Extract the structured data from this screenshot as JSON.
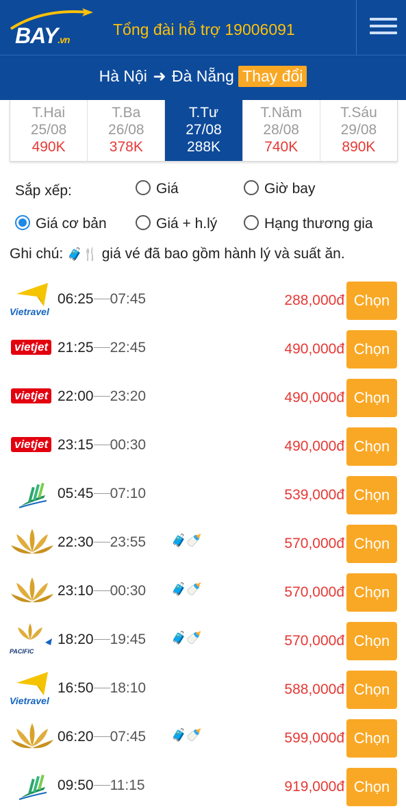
{
  "header": {
    "logo_main": "BAY",
    "logo_suffix": ".vn",
    "hotline": "Tổng đài hỗ trợ 19006091"
  },
  "route": {
    "from": "Hà Nội",
    "to": "Đà Nẵng",
    "change_label": "Thay đổi"
  },
  "dates": [
    {
      "day": "T.Hai",
      "date": "25/08",
      "price": "490K",
      "active": false
    },
    {
      "day": "T.Ba",
      "date": "26/08",
      "price": "378K",
      "active": false
    },
    {
      "day": "T.Tư",
      "date": "27/08",
      "price": "288K",
      "active": true
    },
    {
      "day": "T.Năm",
      "date": "28/08",
      "price": "740K",
      "active": false
    },
    {
      "day": "T.Sáu",
      "date": "29/08",
      "price": "890K",
      "active": false
    }
  ],
  "sort": {
    "label": "Sắp xếp:",
    "options": [
      {
        "label": "Giá",
        "checked": false
      },
      {
        "label": "Giờ bay",
        "checked": false
      },
      {
        "label": "Giá cơ bản",
        "checked": true
      },
      {
        "label": "Giá + h.lý",
        "checked": false
      },
      {
        "label": "Hạng thương gia",
        "checked": false
      }
    ]
  },
  "note": {
    "prefix": "Ghi chú:",
    "text": "giá vé đã bao gồm hành lý và suất ăn."
  },
  "choose_label": "Chọn",
  "airline_labels": {
    "vietravel": "Vietravel",
    "vietjet": "vietjet",
    "pacific": "PACIFIC"
  },
  "flights": [
    {
      "airline": "vietravel",
      "depart": "06:25",
      "arrive": "07:45",
      "amenities": false,
      "price": "288,000đ"
    },
    {
      "airline": "vietjet",
      "depart": "21:25",
      "arrive": "22:45",
      "amenities": false,
      "price": "490,000đ"
    },
    {
      "airline": "vietjet",
      "depart": "22:00",
      "arrive": "23:20",
      "amenities": false,
      "price": "490,000đ"
    },
    {
      "airline": "vietjet",
      "depart": "23:15",
      "arrive": "00:30",
      "amenities": false,
      "price": "490,000đ"
    },
    {
      "airline": "bamboo",
      "depart": "05:45",
      "arrive": "07:10",
      "amenities": false,
      "price": "539,000đ"
    },
    {
      "airline": "vietnam-airlines",
      "depart": "22:30",
      "arrive": "23:55",
      "amenities": true,
      "price": "570,000đ"
    },
    {
      "airline": "vietnam-airlines",
      "depart": "23:10",
      "arrive": "00:30",
      "amenities": true,
      "price": "570,000đ"
    },
    {
      "airline": "pacific",
      "depart": "18:20",
      "arrive": "19:45",
      "amenities": true,
      "price": "570,000đ"
    },
    {
      "airline": "vietravel",
      "depart": "16:50",
      "arrive": "18:10",
      "amenities": false,
      "price": "588,000đ"
    },
    {
      "airline": "vietnam-airlines",
      "depart": "06:20",
      "arrive": "07:45",
      "amenities": true,
      "price": "599,000đ"
    },
    {
      "airline": "bamboo",
      "depart": "09:50",
      "arrive": "11:15",
      "amenities": false,
      "price": "919,000đ"
    }
  ],
  "colors": {
    "brand": "#0d4a9a",
    "accent": "#f9a825",
    "price": "#e53935",
    "radio_checked": "#1e88e5"
  }
}
